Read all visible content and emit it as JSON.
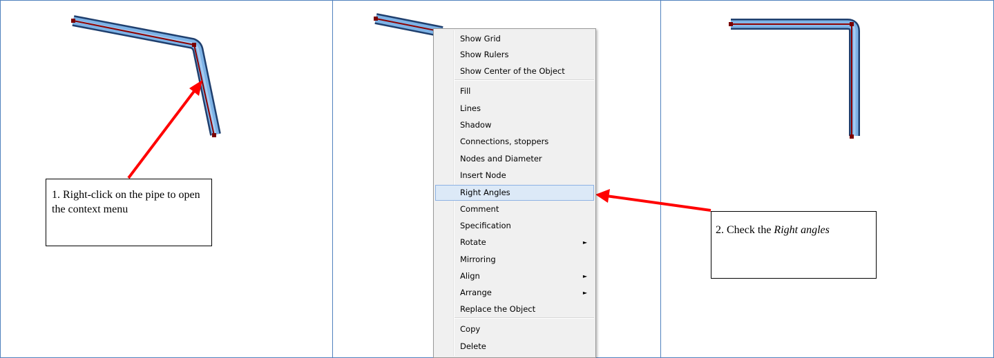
{
  "callouts": {
    "step1": "1. Right-click on the pipe to open the context menu",
    "step2_prefix": "2. Check the ",
    "step2_emphasis": "Right angles"
  },
  "context_menu": {
    "items": [
      {
        "label": "Show Grid"
      },
      {
        "label": "Show Rulers"
      },
      {
        "label": "Show Center of the Object"
      },
      {
        "label": "Fill"
      },
      {
        "label": "Lines"
      },
      {
        "label": "Shadow"
      },
      {
        "label": "Connections, stoppers"
      },
      {
        "label": "Nodes and Diameter"
      },
      {
        "label": "Insert Node"
      },
      {
        "label": "Right Angles",
        "highlighted": true
      },
      {
        "label": "Comment"
      },
      {
        "label": "Specification"
      },
      {
        "label": "Rotate",
        "submenu": true
      },
      {
        "label": "Mirroring"
      },
      {
        "label": "Align",
        "submenu": true
      },
      {
        "label": "Arrange",
        "submenu": true
      },
      {
        "label": "Replace the Object"
      },
      {
        "label": "Copy"
      },
      {
        "label": "Delete"
      }
    ],
    "submenu_glyph": "►"
  },
  "colors": {
    "panel_border": "#4f81bd",
    "pipe_fill": "#6fa8dc",
    "pipe_edge": "#1f3f6e",
    "centerline": "#8b0000",
    "node": "#7a0000",
    "arrow": "#ff0000",
    "menu_highlight": "#dce9f7"
  }
}
